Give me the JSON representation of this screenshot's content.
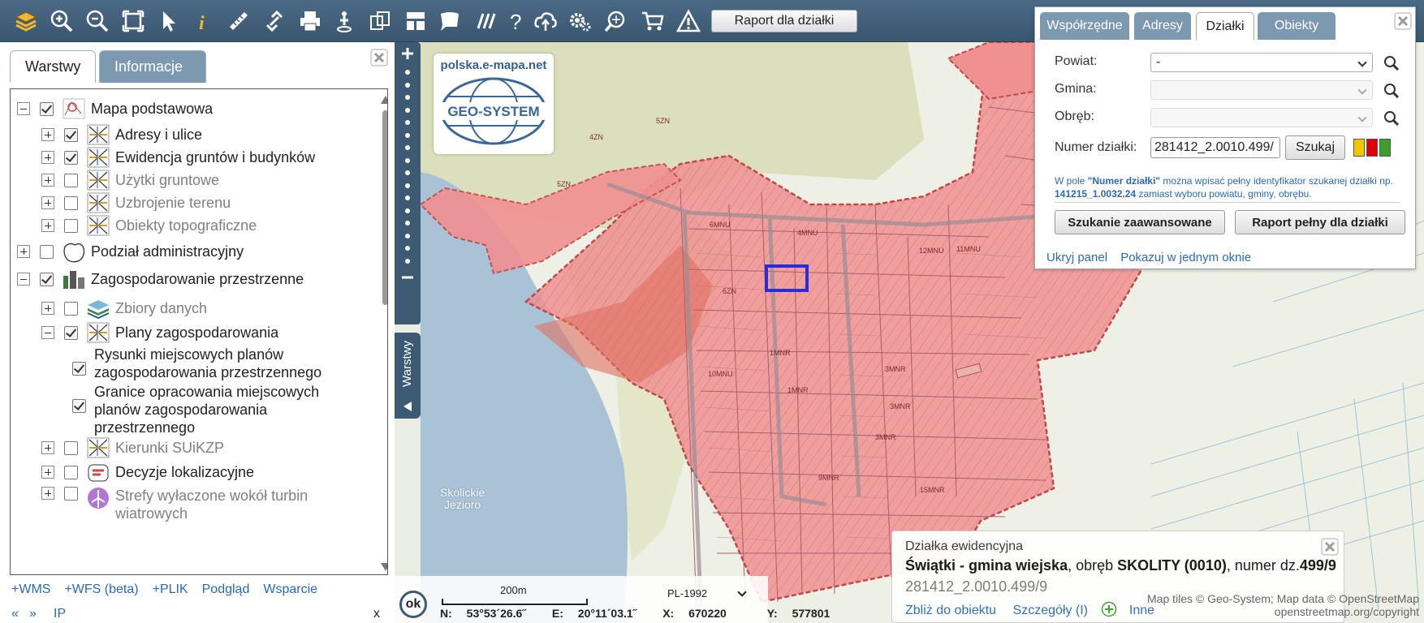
{
  "toolbar": {
    "icons": [
      "layers-icon",
      "zoom-in-icon",
      "zoom-out-icon",
      "zoom-extent-icon",
      "select-pointer-icon",
      "info-icon",
      "measure-ruler-icon",
      "link-icon",
      "print-icon",
      "route-icon",
      "copy-window-icon",
      "layout-icon",
      "comment-icon",
      "hatch-icon",
      "help-icon",
      "cloud-upload-icon",
      "settings-icon",
      "search-map-icon",
      "cart-icon",
      "warning-icon"
    ],
    "report_button": "Raport dla działki"
  },
  "left_panel": {
    "tabs": [
      {
        "label": "Warstwy",
        "active": true
      },
      {
        "label": "Informacje",
        "active": false
      }
    ],
    "layers": [
      {
        "label": "Mapa podstawowa",
        "checked": true,
        "expand": "minus",
        "level": 0,
        "dim": false
      },
      {
        "label": "Adresy i ulice",
        "checked": true,
        "expand": "plus",
        "level": 1,
        "dim": false
      },
      {
        "label": "Ewidencja gruntów i budynków",
        "checked": true,
        "expand": "plus",
        "level": 1,
        "dim": false
      },
      {
        "label": "Użytki gruntowe",
        "checked": false,
        "expand": "plus",
        "level": 1,
        "dim": true
      },
      {
        "label": "Uzbrojenie terenu",
        "checked": false,
        "expand": "plus",
        "level": 1,
        "dim": true
      },
      {
        "label": "Obiekty topograficzne",
        "checked": false,
        "expand": "plus",
        "level": 1,
        "dim": true
      },
      {
        "label": "Podział administracyjny",
        "checked": false,
        "expand": "plus",
        "level": 0,
        "dim": false
      },
      {
        "label": "Zagospodarowanie przestrzenne",
        "checked": true,
        "expand": "minus",
        "level": 0,
        "dim": false
      },
      {
        "label": "Zbiory danych",
        "checked": false,
        "expand": "plus",
        "level": 1,
        "dim": true
      },
      {
        "label": "Plany zagospodarowania",
        "checked": true,
        "expand": "minus",
        "level": 1,
        "dim": false
      },
      {
        "label": "Rysunki miejscowych planów zagospodarowania przestrzennego",
        "checked": true,
        "expand": "",
        "level": 2,
        "dim": false
      },
      {
        "label": "Granice opracowania miejscowych planów zagospodarowania przestrzennego",
        "checked": true,
        "expand": "",
        "level": 2,
        "dim": false
      },
      {
        "label": "Kierunki SUiKZP",
        "checked": false,
        "expand": "plus",
        "level": 1,
        "dim": true
      },
      {
        "label": "Decyzje lokalizacyjne",
        "checked": false,
        "expand": "plus",
        "level": 1,
        "dim": false
      },
      {
        "label": "Strefy wyłaczone wokół turbin wiatrowych",
        "checked": false,
        "expand": "plus",
        "level": 1,
        "dim": true
      }
    ],
    "bottom_links": [
      "+WMS",
      "+WFS (beta)",
      "+PLIK",
      "Podgląd",
      "Wsparcie"
    ],
    "nav": {
      "prev": "«",
      "next": "»",
      "ip": "IP",
      "close": "x"
    }
  },
  "map": {
    "logo_url_text": "polska.e-mapa.net",
    "logo_text": "GEO-SYSTEM",
    "layers_flap": "Warstwy",
    "lake_label": "Skolickie\nJezioro",
    "zone_labels": [
      "4ZN",
      "5ZN",
      "5ZN",
      "6MNU",
      "4MNU",
      "6ZN",
      "10MNU",
      "1MNR",
      "9MNR",
      "3MNR",
      "12MNU",
      "11MNU",
      "3MNR",
      "15MNR",
      "1MNR",
      "3MNR"
    ],
    "attribution_line1": "Map tiles © Geo-System; Map data © OpenStreetMap",
    "attribution_line2": "openstreetmap.org/copyright"
  },
  "search_panel": {
    "tabs": [
      {
        "label": "Współrzędne",
        "active": false
      },
      {
        "label": "Adresy",
        "active": false
      },
      {
        "label": "Działki",
        "active": true
      },
      {
        "label": "Obiekty",
        "active": false
      }
    ],
    "powiat_label": "Powiat:",
    "powiat_value": "-",
    "gmina_label": "Gmina:",
    "gmina_value": "",
    "obreb_label": "Obręb:",
    "obreb_value": "",
    "numer_label": "Numer działki:",
    "numer_value": "281412_2.0010.499/",
    "search_button": "Szukaj",
    "hint_prefix": "W pole ",
    "hint_field": "\"Numer działki\"",
    "hint_mid": " można wpisać pełny identyfikator szukanej działki np. ",
    "hint_example": "141215_1.0032.24",
    "hint_suffix": " zamiast wyboru powiatu, gminy, obrębu.",
    "advanced_button": "Szukanie zaawansowane",
    "full_report_button": "Raport pełny dla działki",
    "hide_link": "Ukryj panel",
    "one_window_link": "Pokazuj w jednym oknie",
    "colors": [
      "#f2c500",
      "#e00000",
      "#3aa02a"
    ]
  },
  "info_popup": {
    "title": "Działka ewidencyjna",
    "gmina": "Świątki - gmina wiejska",
    "obreb_text": ", obręb ",
    "obreb": "SKOLITY (0010)",
    "numer_text": ", numer dz.",
    "numer": "499/9",
    "identifier": "281412_2.0010.499/9",
    "zoom_link": "Zbliż do obiektu",
    "details_link": "Szczegóły (I)",
    "other_link": "Inne"
  },
  "status_bar": {
    "ok": "ok",
    "scale": "200m",
    "crs": "PL-1992",
    "n_label": "N:",
    "n_value": "53°53´26.6˝",
    "e_label": "E:",
    "e_value": "20°11´03.1˝",
    "x_label": "X:",
    "x_value": "670220",
    "y_label": "Y:",
    "y_value": "577801"
  }
}
